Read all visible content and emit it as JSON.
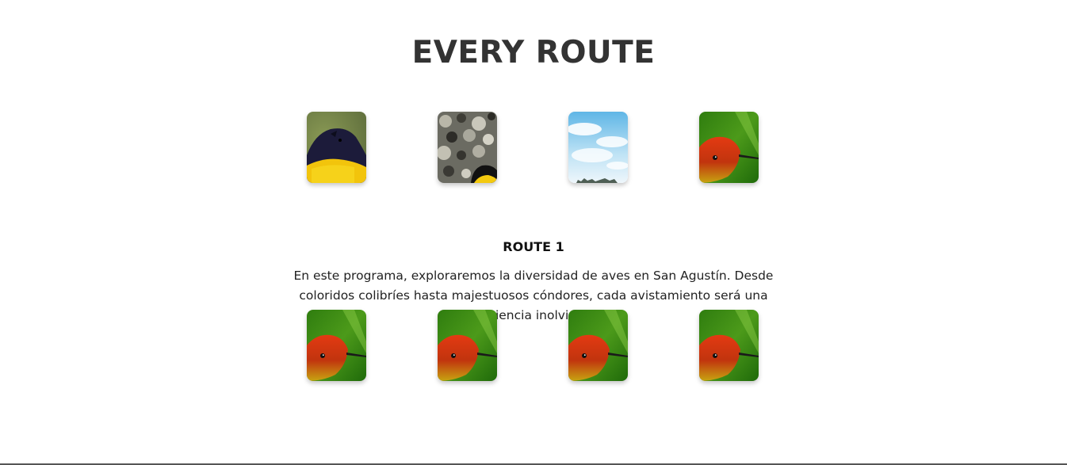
{
  "page": {
    "title": "EVERY ROUTE"
  },
  "top_gallery": [
    {
      "name": "thumb-tanager",
      "subject": "bird with dark head and yellow breast"
    },
    {
      "name": "thumb-lichen-bird",
      "subject": "lichen-covered rock with small yellow bird"
    },
    {
      "name": "thumb-sky",
      "subject": "blue sky with clouds"
    },
    {
      "name": "thumb-hummingbird",
      "subject": "red hummingbird on green"
    }
  ],
  "route": {
    "title": "ROUTE 1",
    "description": "En este programa, exploraremos la diversidad de aves en San Agustín. Desde coloridos colibríes hasta majestuosos cóndores, cada avistamiento será una experiencia inolvidable."
  },
  "bottom_gallery": [
    {
      "name": "thumb-hummingbird",
      "subject": "red hummingbird on green"
    },
    {
      "name": "thumb-hummingbird",
      "subject": "red hummingbird on green"
    },
    {
      "name": "thumb-hummingbird",
      "subject": "red hummingbird on green"
    },
    {
      "name": "thumb-hummingbird",
      "subject": "red hummingbird on green"
    }
  ],
  "colors": {
    "heading": "#333333",
    "text": "#222222",
    "background": "#ffffff"
  }
}
